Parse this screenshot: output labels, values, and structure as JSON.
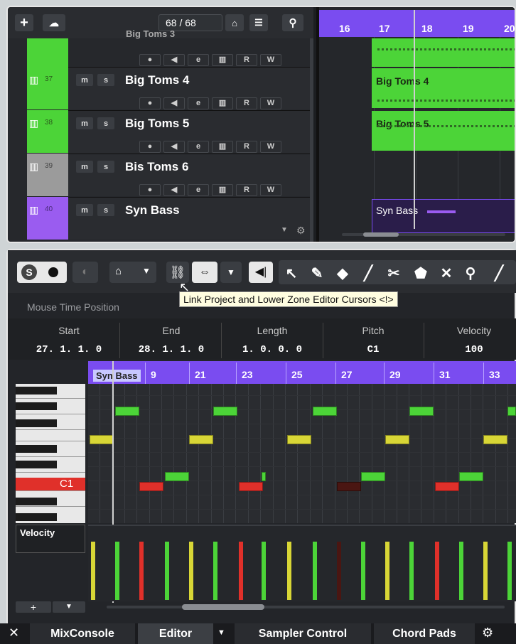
{
  "project": {
    "track_count": "68 / 68",
    "ruler": [
      "16",
      "17",
      "18",
      "19",
      "20"
    ],
    "tracks": [
      {
        "num": "37",
        "name": "Big Toms 4"
      },
      {
        "num": "38",
        "name": "Big Toms 5"
      },
      {
        "num": "39",
        "name": "Bis Toms 6"
      },
      {
        "num": "40",
        "name": "Syn Bass"
      }
    ],
    "partial_track_name": "Big Toms 3",
    "clips": [
      "Big Toms 4",
      "Big Toms 5",
      "Syn Bass"
    ],
    "track_buttons": {
      "mute": "m",
      "solo": "s",
      "read": "R",
      "write": "W"
    }
  },
  "editor": {
    "solo_label": "S",
    "mouse_time_label": "Mouse Time Position",
    "tooltip": "Link Project and Lower Zone Editor Cursors <!>",
    "info": {
      "headers": [
        "Start",
        "End",
        "Length",
        "Pitch",
        "Velocity"
      ],
      "values": [
        "27. 1. 1.   0",
        "28. 1. 1.   0",
        "1. 0. 0.   0",
        "C1",
        "100"
      ]
    },
    "ruler_label": "Syn Bass",
    "ruler": [
      "9",
      "21",
      "23",
      "25",
      "27",
      "29",
      "31",
      "33"
    ],
    "key_label": "C1",
    "velocity_label": "Velocity"
  },
  "tabs": [
    "MixConsole",
    "Editor",
    "Sampler Control",
    "Chord Pads"
  ],
  "colors": {
    "green": "#4cd438",
    "purple": "#7a4cf0",
    "yellow": "#d8d636",
    "red": "#e0302a"
  }
}
